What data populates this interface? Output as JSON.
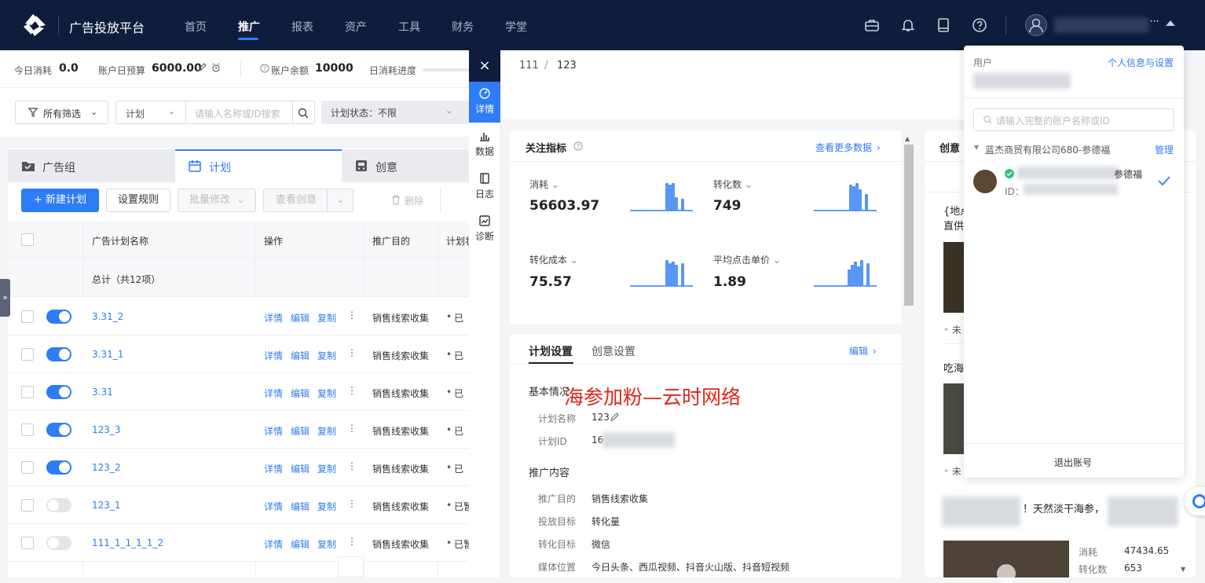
{
  "header": {
    "brand": "广告投放平台",
    "nav": [
      "首页",
      "推广",
      "报表",
      "资产",
      "工具",
      "财务",
      "学堂"
    ],
    "active_nav": "推广",
    "user_dots": "···"
  },
  "stats": {
    "today_spend_label": "今日消耗",
    "today_spend": "0.0",
    "daily_budget_label": "账户日预算",
    "daily_budget": "6000.00",
    "balance_label": "账户余额",
    "balance": "10000",
    "progress_label": "日消耗进度"
  },
  "filters": {
    "all_filter": "所有筛选",
    "plan_select": "计划",
    "search_placeholder": "请输入名称或ID搜索",
    "status": "计划状态：不限"
  },
  "tabs": [
    "广告组",
    "计划",
    "创意"
  ],
  "toolbar": {
    "new_plan": "+ 新建计划",
    "rules": "设置规则",
    "batch": "批量修改",
    "view_creative": "查看创意",
    "delete": "删除"
  },
  "table": {
    "columns": [
      "广告计划名称",
      "操作",
      "推广目的",
      "计划状"
    ],
    "total": "总计（共12项）",
    "actions": [
      "详情",
      "编辑",
      "复制"
    ],
    "rows": [
      {
        "name": "3.31_2",
        "on": true,
        "purpose": "销售线索收集",
        "status": "已"
      },
      {
        "name": "3.31_1",
        "on": true,
        "purpose": "销售线索收集",
        "status": "已"
      },
      {
        "name": "3.31",
        "on": true,
        "purpose": "销售线索收集",
        "status": "已"
      },
      {
        "name": "123_3",
        "on": true,
        "purpose": "销售线索收集",
        "status": "已"
      },
      {
        "name": "123_2",
        "on": true,
        "purpose": "销售线索收集",
        "status": "已"
      },
      {
        "name": "123_1",
        "on": false,
        "purpose": "销售线索收集",
        "status": "已暂"
      },
      {
        "name": "111_1_1_1_1_2",
        "on": false,
        "purpose": "销售线索收集",
        "status": "已暂"
      }
    ]
  },
  "drawer": {
    "close": "×",
    "nav": [
      "详情",
      "数据",
      "日志",
      "诊断"
    ],
    "breadcrumb": [
      "111",
      "/",
      "123"
    ],
    "metrics_title": "关注指标",
    "more_data": "查看更多数据",
    "metrics": [
      {
        "label": "消耗",
        "value": "56603.97"
      },
      {
        "label": "转化数",
        "value": "749"
      },
      {
        "label": "转化成本",
        "value": "75.57"
      },
      {
        "label": "平均点击单价",
        "value": "1.89"
      }
    ],
    "settings_tabs": [
      "计划设置",
      "创意设置"
    ],
    "edit": "编辑",
    "basic_title": "基本情况",
    "plan_name_label": "计划名称",
    "plan_name": "123",
    "plan_id_label": "计划ID",
    "plan_id": "16",
    "promo_title": "推广内容",
    "promo": [
      {
        "k": "推广目的",
        "v": "销售线索收集"
      },
      {
        "k": "投放目标",
        "v": "转化量"
      },
      {
        "k": "转化目标",
        "v": "微信"
      },
      {
        "k": "媒体位置",
        "v": "今日头条、西瓜视频、抖音火山版、抖音短视频"
      }
    ],
    "creative_title": "创意",
    "creative_text1": "{地点",
    "creative_text2": "直供",
    "creative_item": "未",
    "creative_text3": "吃海",
    "creative_text4": "！天然淡干海参，",
    "creative_stats": [
      {
        "k": "消耗",
        "v": "47434.65"
      },
      {
        "k": "转化数",
        "v": "653"
      }
    ]
  },
  "watermark": "海参加粉—云时网络",
  "popover": {
    "user_label": "用户",
    "settings_link": "个人信息与设置",
    "search_placeholder": "请输入完整的账户名称或ID",
    "company": "蓝杰商贸有限公司680-参德福",
    "manage": "管理",
    "account_suffix": "参德福",
    "id_label": "ID：",
    "logout": "退出账号"
  },
  "colors": {
    "nav_bg": "#0f1d3c",
    "accent": "#2e7cf6",
    "watermark": "#e0251b"
  }
}
